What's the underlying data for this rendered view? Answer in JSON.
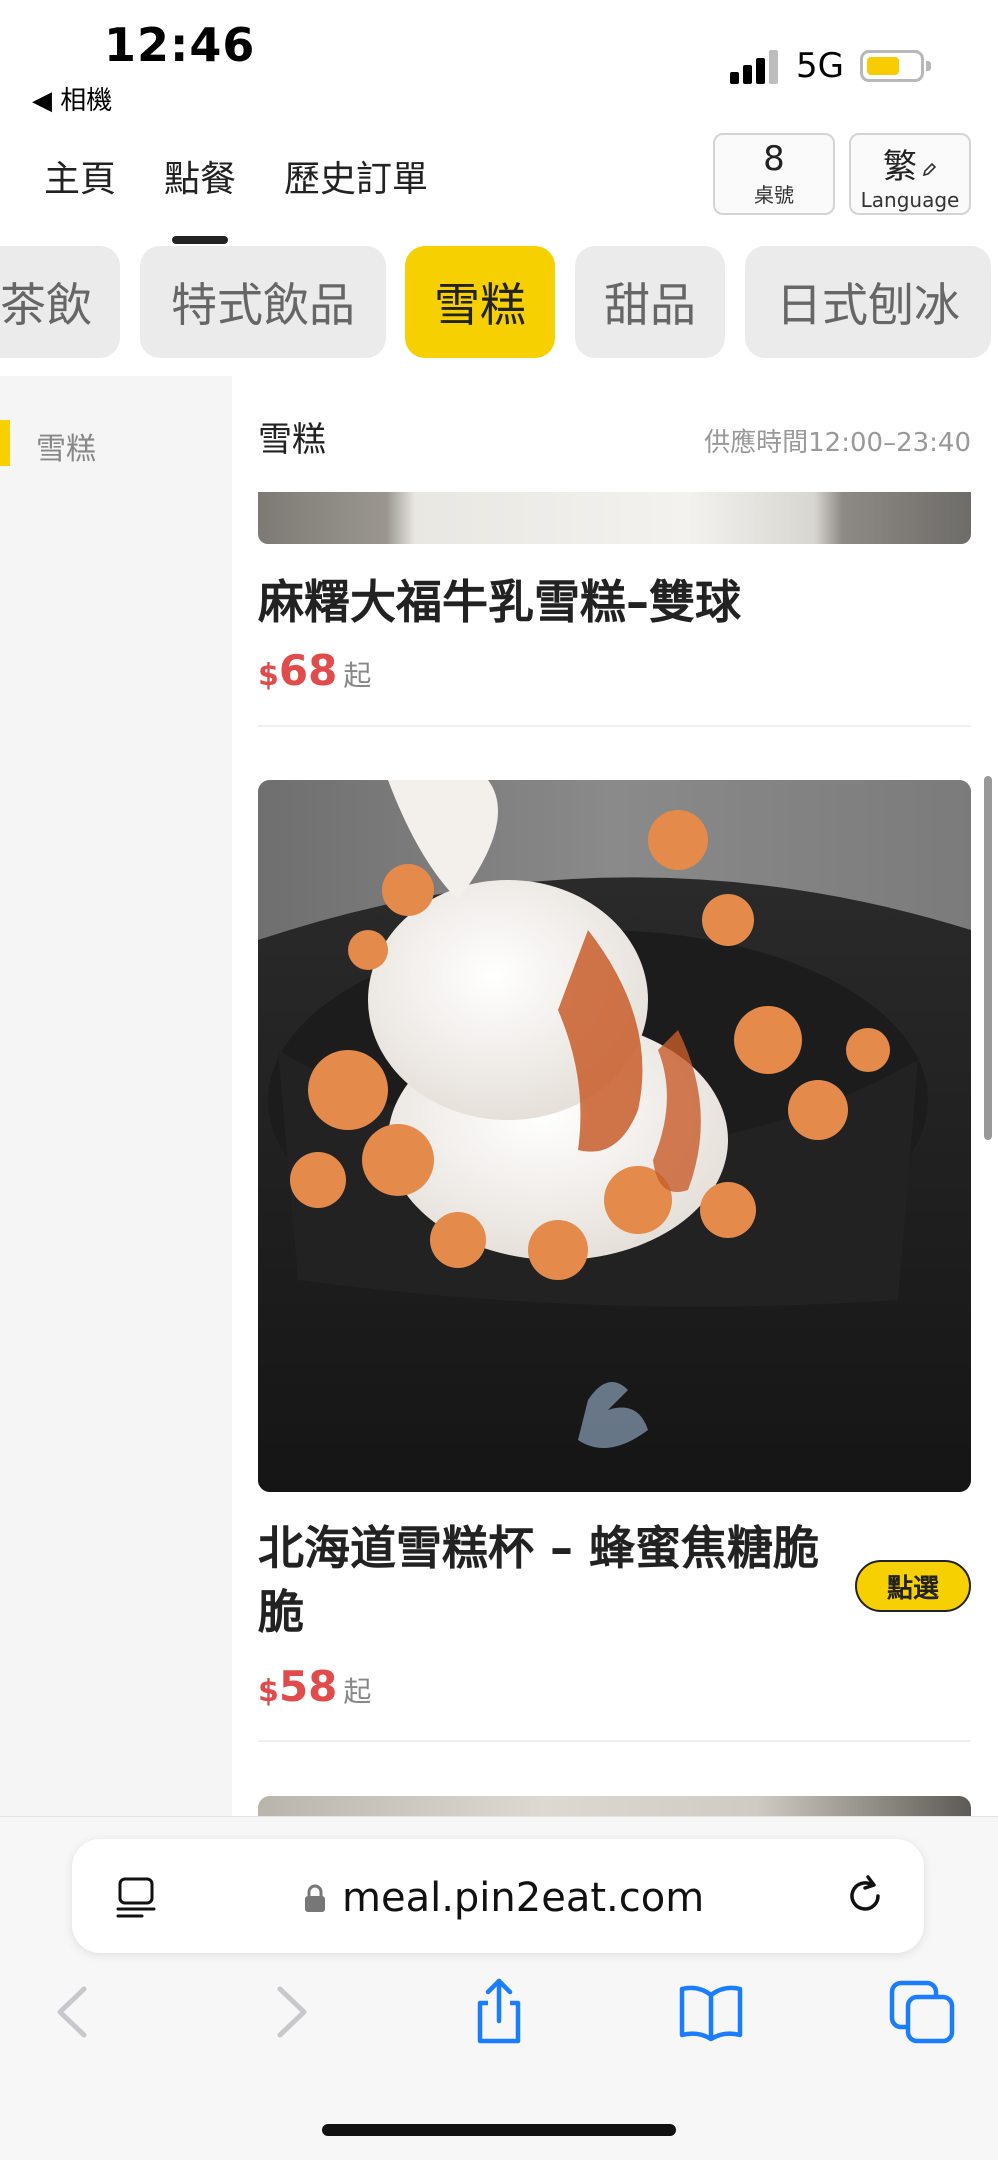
{
  "status_bar": {
    "time": "12:46",
    "back_app": "◀ 相機",
    "network": "5G",
    "icons": [
      "signal-icon",
      "battery-icon"
    ]
  },
  "nav": {
    "tabs": [
      {
        "label": "主頁",
        "active": false
      },
      {
        "label": "點餐",
        "active": true
      },
      {
        "label": "歷史訂單",
        "active": false
      }
    ],
    "table": {
      "number": "8",
      "label": "桌號"
    },
    "language": {
      "value": "繁",
      "label": "Language",
      "icon": "pencil-icon"
    }
  },
  "categories": [
    {
      "label": "茶飲",
      "active": false
    },
    {
      "label": "特式飲品",
      "active": false
    },
    {
      "label": "雪糕",
      "active": true
    },
    {
      "label": "甜品",
      "active": false
    },
    {
      "label": "日式刨冰",
      "active": false
    }
  ],
  "sidebar": {
    "items": [
      {
        "label": "雪糕",
        "active": true
      }
    ]
  },
  "section": {
    "title": "雪糕",
    "hours": "供應時間12:00–23:40"
  },
  "items": [
    {
      "name": "麻糬大福牛乳雪糕–雙球",
      "currency": "$",
      "price": "68",
      "price_suffix": "起"
    },
    {
      "name": "北海道雪糕杯 – 蜂蜜焦糖脆脆",
      "currency": "$",
      "price": "58",
      "price_suffix": "起",
      "button": "點選"
    }
  ],
  "browser": {
    "url": "meal.pin2eat.com",
    "icons": [
      "reader-icon",
      "lock-icon",
      "reload-icon",
      "back-icon",
      "forward-icon",
      "share-icon",
      "bookmarks-icon",
      "tabs-icon"
    ]
  },
  "colors": {
    "accent": "#f6d000",
    "price": "#e24b4b",
    "ios_blue": "#1a7cff"
  }
}
